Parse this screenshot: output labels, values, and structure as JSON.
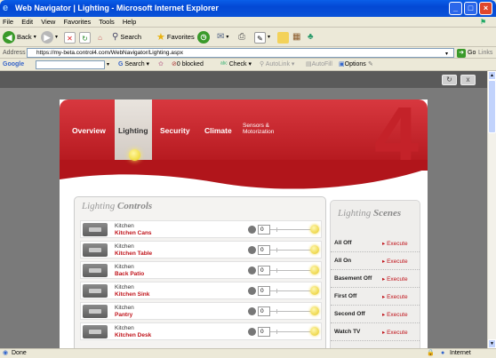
{
  "window": {
    "title": "Web Navigator | Lighting - Microsoft Internet Explorer"
  },
  "menu": [
    "File",
    "Edit",
    "View",
    "Favorites",
    "Tools",
    "Help"
  ],
  "toolbar": {
    "back": "Back",
    "search": "Search",
    "favorites": "Favorites"
  },
  "address": {
    "label": "Address",
    "url": "https://my-beta.control4.com/WebNavigator/Lighting.aspx",
    "go": "Go",
    "links": "Links"
  },
  "google": {
    "logo": "Google",
    "search": "Search",
    "blocked": "0 blocked",
    "check": "Check",
    "autolink": "AutoLink",
    "autofill": "AutoFill",
    "options": "Options"
  },
  "nav": {
    "overview": "Overview",
    "lighting": "Lighting",
    "security": "Security",
    "climate": "Climate",
    "sensors": "Sensors &",
    "motorization": "Motorization"
  },
  "controls": {
    "title_a": "Lighting",
    "title_b": "Controls",
    "rows": [
      {
        "room": "Kitchen",
        "device": "Kitchen Cans",
        "level": "0"
      },
      {
        "room": "Kitchen",
        "device": "Kitchen Table",
        "level": "0"
      },
      {
        "room": "Kitchen",
        "device": "Back Patio",
        "level": "0"
      },
      {
        "room": "Kitchen",
        "device": "Kitchen Sink",
        "level": "0"
      },
      {
        "room": "Kitchen",
        "device": "Pantry",
        "level": "0"
      },
      {
        "room": "Kitchen",
        "device": "Kitchen Desk",
        "level": "0"
      }
    ]
  },
  "scenes": {
    "title_a": "Lighting",
    "title_b": "Scenes",
    "items": [
      {
        "name": "All Off",
        "action": "▸ Execute"
      },
      {
        "name": "All On",
        "action": "▸ Execute"
      },
      {
        "name": "Basement Off",
        "action": "▸ Execute"
      },
      {
        "name": "First Off",
        "action": "▸ Execute"
      },
      {
        "name": "Second Off",
        "action": "▸ Execute"
      },
      {
        "name": "Watch TV",
        "action": "▸ Execute"
      }
    ]
  },
  "status": {
    "left": "Done",
    "zone": "Internet"
  }
}
